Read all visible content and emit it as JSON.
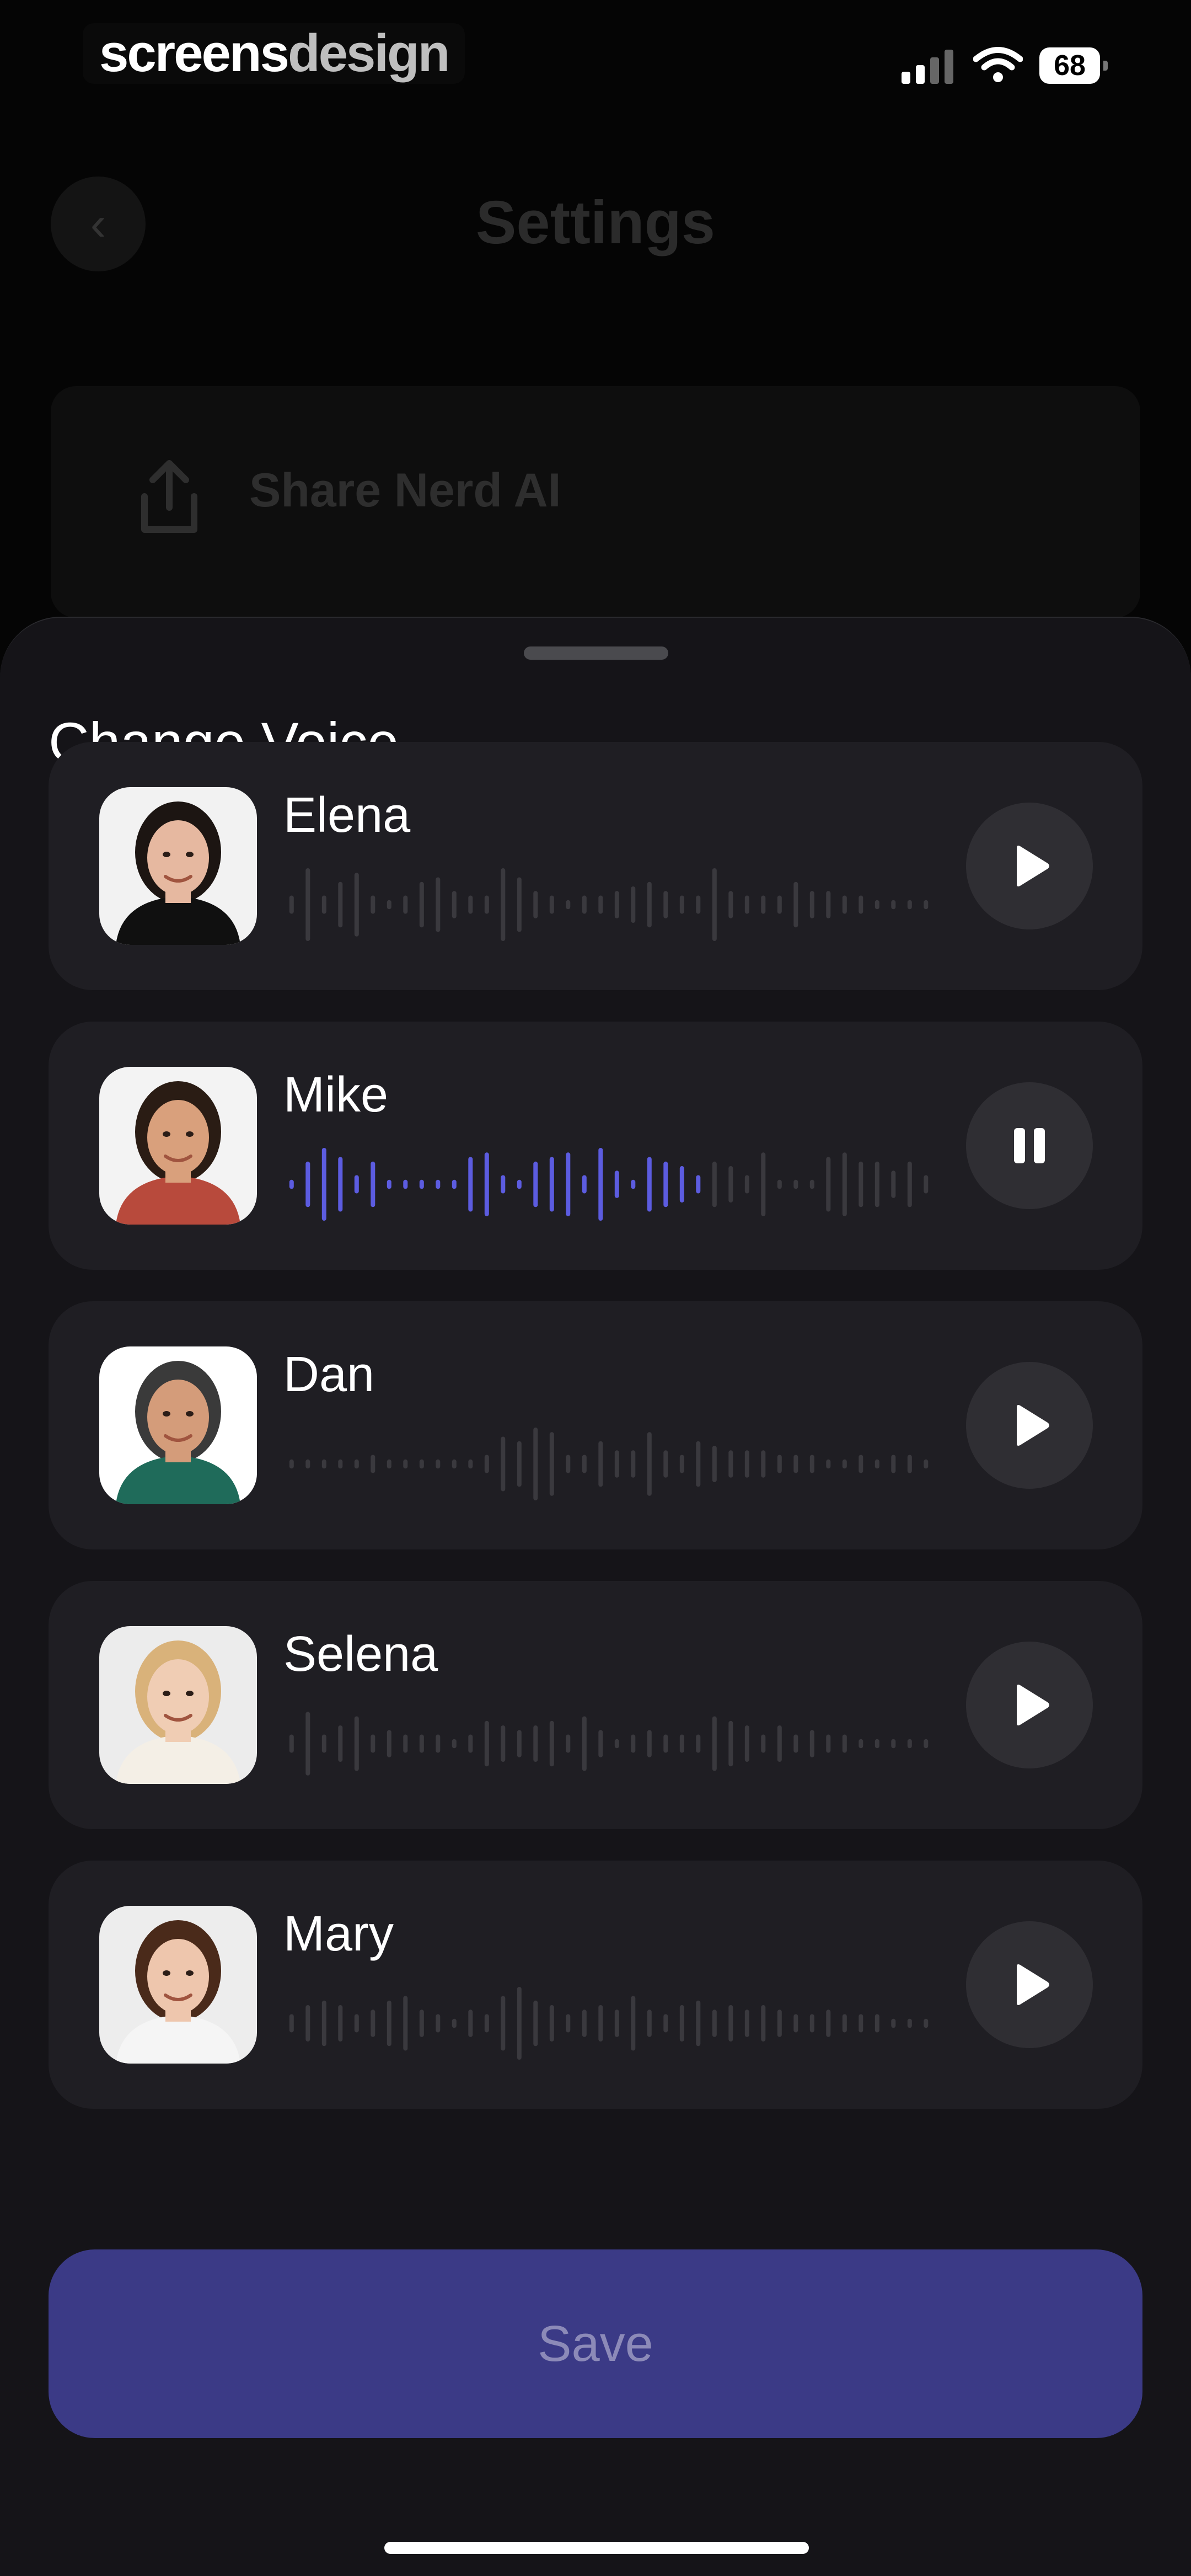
{
  "status_bar": {
    "brand_part1": "screens",
    "brand_part2": "design",
    "battery": "68"
  },
  "background": {
    "title": "Settings",
    "share_label": "Share Nerd AI"
  },
  "sheet": {
    "title": "Change Voice",
    "voices": [
      {
        "name": "Elena",
        "state": "play",
        "skin": "#e6b8a0",
        "hair": "#1c1512",
        "shirt": "#101010",
        "bg": "#f2f2f2"
      },
      {
        "name": "Mike",
        "state": "pause",
        "skin": "#d9a07c",
        "hair": "#2a1c14",
        "shirt": "#b84a3c",
        "bg": "#f3f3f3"
      },
      {
        "name": "Dan",
        "state": "play",
        "skin": "#d49c7a",
        "hair": "#3a3a3a",
        "shirt": "#1f6b5a",
        "bg": "#ffffff"
      },
      {
        "name": "Selena",
        "state": "play",
        "skin": "#f0cdb4",
        "hair": "#d9b27a",
        "shirt": "#f4efe6",
        "bg": "#ececec"
      },
      {
        "name": "Mary",
        "state": "play",
        "skin": "#eec6ad",
        "hair": "#4a2a1a",
        "shirt": "#f5f5f5",
        "bg": "#ededed"
      }
    ],
    "save_label": "Save"
  },
  "colors": {
    "accent": "#5c5ce0",
    "save_button": "#3b3a86",
    "wave_inactive": "#3a393e"
  }
}
